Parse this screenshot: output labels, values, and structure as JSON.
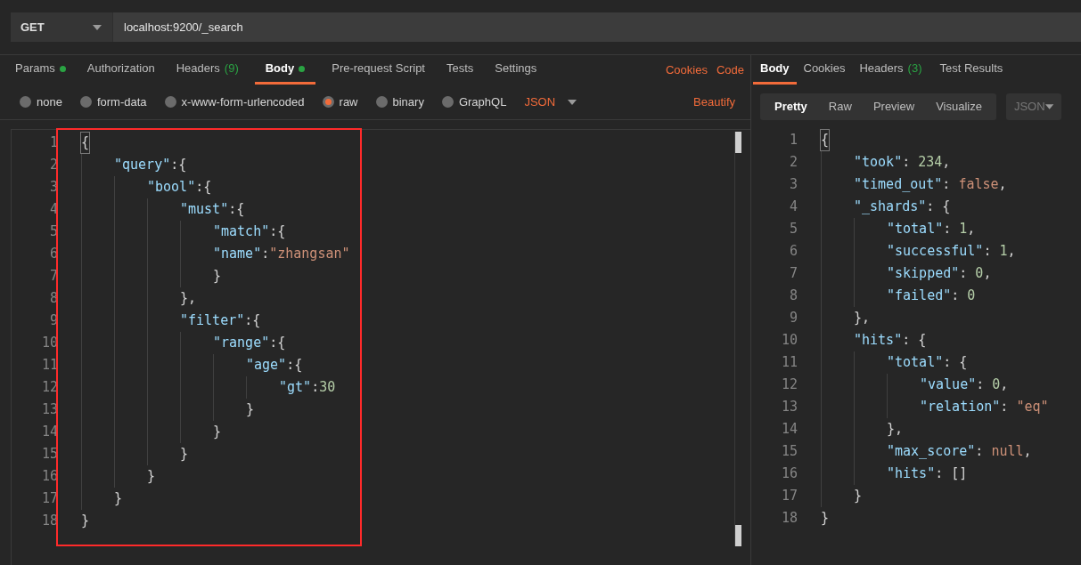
{
  "request": {
    "method": "GET",
    "url": "localhost:9200/_search"
  },
  "request_tabs": [
    {
      "label": "Params",
      "dot": true,
      "selected": false
    },
    {
      "label": "Authorization",
      "dot": false,
      "selected": false
    },
    {
      "label": "Headers",
      "count": "(9)",
      "dot": false,
      "selected": false
    },
    {
      "label": "Body",
      "dot": true,
      "selected": true
    },
    {
      "label": "Pre-request Script",
      "dot": false,
      "selected": false
    },
    {
      "label": "Tests",
      "dot": false,
      "selected": false
    },
    {
      "label": "Settings",
      "dot": false,
      "selected": false
    }
  ],
  "request_links": [
    "Cookies",
    "Code"
  ],
  "body_types": [
    {
      "label": "none",
      "selected": false
    },
    {
      "label": "form-data",
      "selected": false
    },
    {
      "label": "x-www-form-urlencoded",
      "selected": false
    },
    {
      "label": "raw",
      "selected": true
    },
    {
      "label": "binary",
      "selected": false
    },
    {
      "label": "GraphQL",
      "selected": false
    }
  ],
  "format": "JSON",
  "beautify": "Beautify",
  "request_body": [
    {
      "number": "1",
      "tokens": [
        {
          "kind": "punct",
          "text": "{"
        }
      ]
    },
    {
      "number": "2",
      "tokens": [
        {
          "kind": "key",
          "text": "    \"query\""
        },
        {
          "kind": "punct",
          "text": ":{"
        }
      ]
    },
    {
      "number": "3",
      "tokens": [
        {
          "kind": "key",
          "text": "        \"bool\""
        },
        {
          "kind": "punct",
          "text": ":{"
        }
      ]
    },
    {
      "number": "4",
      "tokens": [
        {
          "kind": "key",
          "text": "            \"must\""
        },
        {
          "kind": "punct",
          "text": ":{"
        }
      ]
    },
    {
      "number": "5",
      "tokens": [
        {
          "kind": "key",
          "text": "                \"match\""
        },
        {
          "kind": "punct",
          "text": ":{"
        }
      ]
    },
    {
      "number": "6",
      "tokens": [
        {
          "kind": "key",
          "text": "                \"name\""
        },
        {
          "kind": "punct",
          "text": ":"
        },
        {
          "kind": "string",
          "text": "\"zhangsan\""
        }
      ]
    },
    {
      "number": "7",
      "tokens": [
        {
          "kind": "punct",
          "text": "                }"
        }
      ]
    },
    {
      "number": "8",
      "tokens": [
        {
          "kind": "punct",
          "text": "            },"
        }
      ]
    },
    {
      "number": "9",
      "tokens": [
        {
          "kind": "key",
          "text": "            \"filter\""
        },
        {
          "kind": "punct",
          "text": ":{"
        }
      ]
    },
    {
      "number": "10",
      "tokens": [
        {
          "kind": "key",
          "text": "                \"range\""
        },
        {
          "kind": "punct",
          "text": ":{"
        }
      ]
    },
    {
      "number": "11",
      "tokens": [
        {
          "kind": "key",
          "text": "                    \"age\""
        },
        {
          "kind": "punct",
          "text": ":{"
        }
      ]
    },
    {
      "number": "12",
      "tokens": [
        {
          "kind": "key",
          "text": "                        \"gt\""
        },
        {
          "kind": "punct",
          "text": ":"
        },
        {
          "kind": "number",
          "text": "30"
        }
      ]
    },
    {
      "number": "13",
      "tokens": [
        {
          "kind": "punct",
          "text": "                    }"
        }
      ]
    },
    {
      "number": "14",
      "tokens": [
        {
          "kind": "punct",
          "text": "                }"
        }
      ]
    },
    {
      "number": "15",
      "tokens": [
        {
          "kind": "punct",
          "text": "            }"
        }
      ]
    },
    {
      "number": "16",
      "tokens": [
        {
          "kind": "punct",
          "text": "        }"
        }
      ]
    },
    {
      "number": "17",
      "tokens": [
        {
          "kind": "punct",
          "text": "    }"
        }
      ]
    },
    {
      "number": "18",
      "tokens": [
        {
          "kind": "punct",
          "text": "}"
        }
      ]
    }
  ],
  "response_tabs": [
    {
      "label": "Body",
      "selected": true
    },
    {
      "label": "Cookies",
      "selected": false
    },
    {
      "label": "Headers",
      "count": "(3)",
      "selected": false
    },
    {
      "label": "Test Results",
      "selected": false
    }
  ],
  "view_modes": [
    {
      "label": "Pretty",
      "selected": true
    },
    {
      "label": "Raw",
      "selected": false
    },
    {
      "label": "Preview",
      "selected": false
    },
    {
      "label": "Visualize",
      "selected": false
    }
  ],
  "response_format": "JSON",
  "response_body": [
    {
      "number": "1",
      "tokens": [
        {
          "kind": "punct",
          "text": "{"
        }
      ]
    },
    {
      "number": "2",
      "tokens": [
        {
          "kind": "key",
          "text": "    \"took\""
        },
        {
          "kind": "punct",
          "text": ": "
        },
        {
          "kind": "number",
          "text": "234"
        },
        {
          "kind": "punct",
          "text": ","
        }
      ]
    },
    {
      "number": "3",
      "tokens": [
        {
          "kind": "key",
          "text": "    \"timed_out\""
        },
        {
          "kind": "punct",
          "text": ": "
        },
        {
          "kind": "literal",
          "text": "false"
        },
        {
          "kind": "punct",
          "text": ","
        }
      ]
    },
    {
      "number": "4",
      "tokens": [
        {
          "kind": "key",
          "text": "    \"_shards\""
        },
        {
          "kind": "punct",
          "text": ": {"
        }
      ]
    },
    {
      "number": "5",
      "tokens": [
        {
          "kind": "key",
          "text": "        \"total\""
        },
        {
          "kind": "punct",
          "text": ": "
        },
        {
          "kind": "number",
          "text": "1"
        },
        {
          "kind": "punct",
          "text": ","
        }
      ]
    },
    {
      "number": "6",
      "tokens": [
        {
          "kind": "key",
          "text": "        \"successful\""
        },
        {
          "kind": "punct",
          "text": ": "
        },
        {
          "kind": "number",
          "text": "1"
        },
        {
          "kind": "punct",
          "text": ","
        }
      ]
    },
    {
      "number": "7",
      "tokens": [
        {
          "kind": "key",
          "text": "        \"skipped\""
        },
        {
          "kind": "punct",
          "text": ": "
        },
        {
          "kind": "number",
          "text": "0"
        },
        {
          "kind": "punct",
          "text": ","
        }
      ]
    },
    {
      "number": "8",
      "tokens": [
        {
          "kind": "key",
          "text": "        \"failed\""
        },
        {
          "kind": "punct",
          "text": ": "
        },
        {
          "kind": "number",
          "text": "0"
        }
      ]
    },
    {
      "number": "9",
      "tokens": [
        {
          "kind": "punct",
          "text": "    },"
        }
      ]
    },
    {
      "number": "10",
      "tokens": [
        {
          "kind": "key",
          "text": "    \"hits\""
        },
        {
          "kind": "punct",
          "text": ": {"
        }
      ]
    },
    {
      "number": "11",
      "tokens": [
        {
          "kind": "key",
          "text": "        \"total\""
        },
        {
          "kind": "punct",
          "text": ": {"
        }
      ]
    },
    {
      "number": "12",
      "tokens": [
        {
          "kind": "key",
          "text": "            \"value\""
        },
        {
          "kind": "punct",
          "text": ": "
        },
        {
          "kind": "number",
          "text": "0"
        },
        {
          "kind": "punct",
          "text": ","
        }
      ]
    },
    {
      "number": "13",
      "tokens": [
        {
          "kind": "key",
          "text": "            \"relation\""
        },
        {
          "kind": "punct",
          "text": ": "
        },
        {
          "kind": "string",
          "text": "\"eq\""
        }
      ]
    },
    {
      "number": "14",
      "tokens": [
        {
          "kind": "punct",
          "text": "        },"
        }
      ]
    },
    {
      "number": "15",
      "tokens": [
        {
          "kind": "key",
          "text": "        \"max_score\""
        },
        {
          "kind": "punct",
          "text": ": "
        },
        {
          "kind": "literal",
          "text": "null"
        },
        {
          "kind": "punct",
          "text": ","
        }
      ]
    },
    {
      "number": "16",
      "tokens": [
        {
          "kind": "key",
          "text": "        \"hits\""
        },
        {
          "kind": "punct",
          "text": ": []"
        }
      ]
    },
    {
      "number": "17",
      "tokens": [
        {
          "kind": "punct",
          "text": "    }"
        }
      ]
    },
    {
      "number": "18",
      "tokens": [
        {
          "kind": "punct",
          "text": "}"
        }
      ]
    }
  ]
}
